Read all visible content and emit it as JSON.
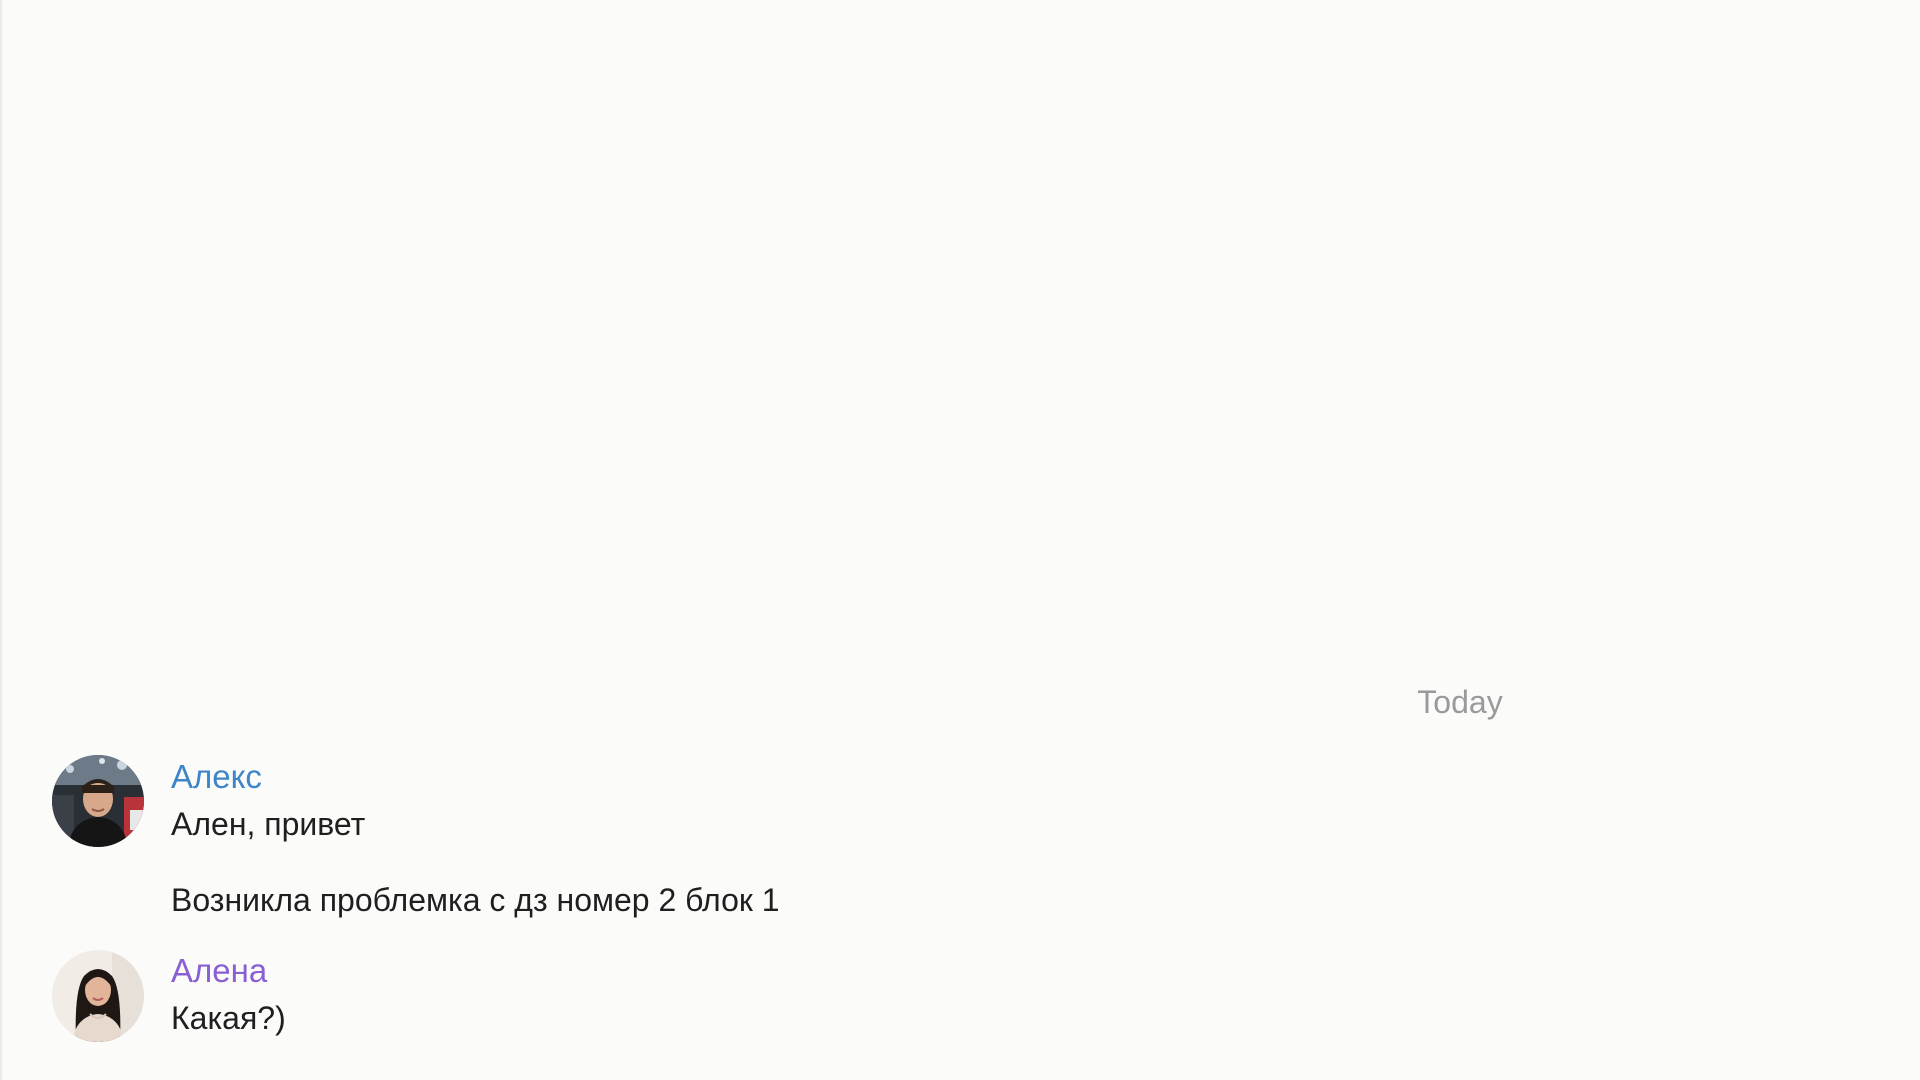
{
  "chat": {
    "date_separator": "Today",
    "groups": [
      {
        "sender": "Алекс",
        "sender_color": "#3f86c8",
        "avatar": "avatar-photo-alex",
        "messages": [
          "Ален, привет",
          "Возникла проблемка с дз номер 2 блок 1"
        ]
      },
      {
        "sender": "Алена",
        "sender_color": "#8a5fd4",
        "avatar": "avatar-photo-alena",
        "messages": [
          "Какая?)"
        ]
      }
    ]
  }
}
